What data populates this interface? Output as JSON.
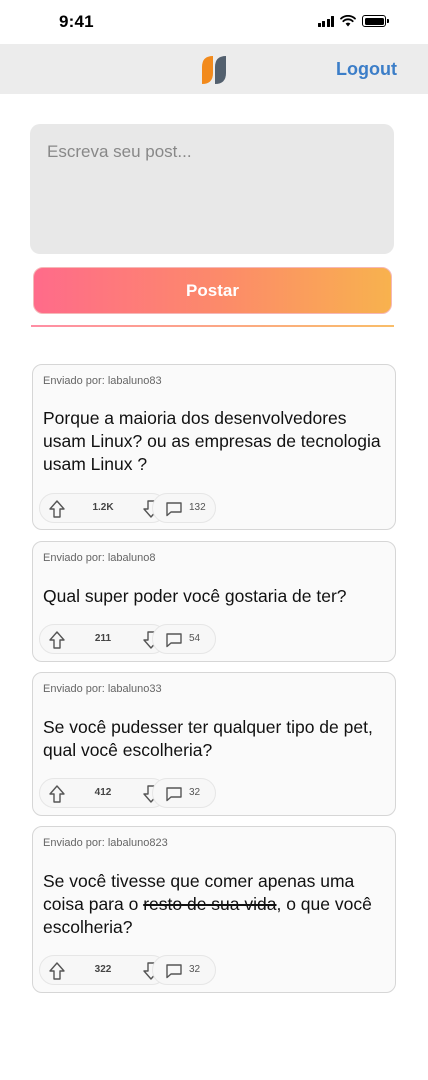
{
  "status_bar": {
    "time": "9:41"
  },
  "header": {
    "logout_label": "Logout",
    "logo_colors": [
      "#f28a1c",
      "#53606e"
    ]
  },
  "composer": {
    "placeholder": "Escreva seu post..."
  },
  "post_button": {
    "label": "Postar"
  },
  "posts": [
    {
      "author": "Enviado por: labaluno83",
      "text": "Porque a maioria dos desenvolvedores usam Linux? ou as empresas de tecnologia usam Linux ?",
      "votes": "1.2K",
      "comments": "132"
    },
    {
      "author": "Enviado por: labaluno8",
      "text": "Qual super poder você gostaria de ter?",
      "votes": "211",
      "comments": "54"
    },
    {
      "author": "Enviado por: labaluno33",
      "text": "Se você pudesser ter qualquer tipo de pet, qual você escolheria?",
      "votes": "412",
      "comments": "32"
    },
    {
      "author": "Enviado por: labaluno823",
      "text_before": "Se você tivesse que comer apenas uma coisa para o ",
      "text_strike": "resto de sua vida",
      "text_after": ", o que você escolheria?",
      "votes": "322",
      "comments": "32"
    }
  ]
}
